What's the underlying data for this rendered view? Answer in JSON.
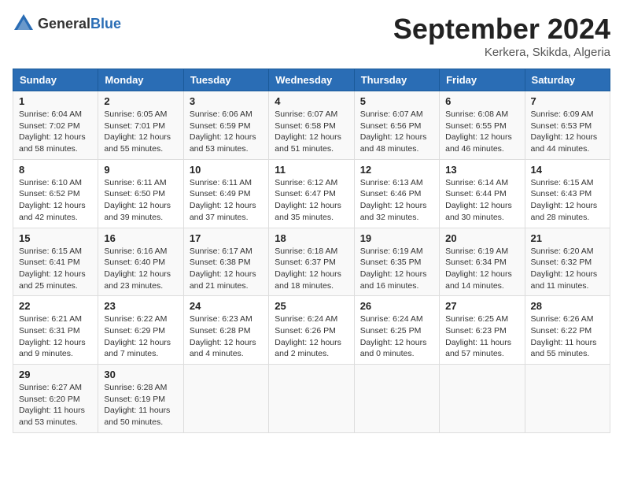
{
  "header": {
    "logo_general": "General",
    "logo_blue": "Blue",
    "title": "September 2024",
    "location": "Kerkera, Skikda, Algeria"
  },
  "columns": [
    "Sunday",
    "Monday",
    "Tuesday",
    "Wednesday",
    "Thursday",
    "Friday",
    "Saturday"
  ],
  "weeks": [
    [
      {
        "day": "1",
        "sunrise": "6:04 AM",
        "sunset": "7:02 PM",
        "daylight": "12 hours and 58 minutes."
      },
      {
        "day": "2",
        "sunrise": "6:05 AM",
        "sunset": "7:01 PM",
        "daylight": "12 hours and 55 minutes."
      },
      {
        "day": "3",
        "sunrise": "6:06 AM",
        "sunset": "6:59 PM",
        "daylight": "12 hours and 53 minutes."
      },
      {
        "day": "4",
        "sunrise": "6:07 AM",
        "sunset": "6:58 PM",
        "daylight": "12 hours and 51 minutes."
      },
      {
        "day": "5",
        "sunrise": "6:07 AM",
        "sunset": "6:56 PM",
        "daylight": "12 hours and 48 minutes."
      },
      {
        "day": "6",
        "sunrise": "6:08 AM",
        "sunset": "6:55 PM",
        "daylight": "12 hours and 46 minutes."
      },
      {
        "day": "7",
        "sunrise": "6:09 AM",
        "sunset": "6:53 PM",
        "daylight": "12 hours and 44 minutes."
      }
    ],
    [
      {
        "day": "8",
        "sunrise": "6:10 AM",
        "sunset": "6:52 PM",
        "daylight": "12 hours and 42 minutes."
      },
      {
        "day": "9",
        "sunrise": "6:11 AM",
        "sunset": "6:50 PM",
        "daylight": "12 hours and 39 minutes."
      },
      {
        "day": "10",
        "sunrise": "6:11 AM",
        "sunset": "6:49 PM",
        "daylight": "12 hours and 37 minutes."
      },
      {
        "day": "11",
        "sunrise": "6:12 AM",
        "sunset": "6:47 PM",
        "daylight": "12 hours and 35 minutes."
      },
      {
        "day": "12",
        "sunrise": "6:13 AM",
        "sunset": "6:46 PM",
        "daylight": "12 hours and 32 minutes."
      },
      {
        "day": "13",
        "sunrise": "6:14 AM",
        "sunset": "6:44 PM",
        "daylight": "12 hours and 30 minutes."
      },
      {
        "day": "14",
        "sunrise": "6:15 AM",
        "sunset": "6:43 PM",
        "daylight": "12 hours and 28 minutes."
      }
    ],
    [
      {
        "day": "15",
        "sunrise": "6:15 AM",
        "sunset": "6:41 PM",
        "daylight": "12 hours and 25 minutes."
      },
      {
        "day": "16",
        "sunrise": "6:16 AM",
        "sunset": "6:40 PM",
        "daylight": "12 hours and 23 minutes."
      },
      {
        "day": "17",
        "sunrise": "6:17 AM",
        "sunset": "6:38 PM",
        "daylight": "12 hours and 21 minutes."
      },
      {
        "day": "18",
        "sunrise": "6:18 AM",
        "sunset": "6:37 PM",
        "daylight": "12 hours and 18 minutes."
      },
      {
        "day": "19",
        "sunrise": "6:19 AM",
        "sunset": "6:35 PM",
        "daylight": "12 hours and 16 minutes."
      },
      {
        "day": "20",
        "sunrise": "6:19 AM",
        "sunset": "6:34 PM",
        "daylight": "12 hours and 14 minutes."
      },
      {
        "day": "21",
        "sunrise": "6:20 AM",
        "sunset": "6:32 PM",
        "daylight": "12 hours and 11 minutes."
      }
    ],
    [
      {
        "day": "22",
        "sunrise": "6:21 AM",
        "sunset": "6:31 PM",
        "daylight": "12 hours and 9 minutes."
      },
      {
        "day": "23",
        "sunrise": "6:22 AM",
        "sunset": "6:29 PM",
        "daylight": "12 hours and 7 minutes."
      },
      {
        "day": "24",
        "sunrise": "6:23 AM",
        "sunset": "6:28 PM",
        "daylight": "12 hours and 4 minutes."
      },
      {
        "day": "25",
        "sunrise": "6:24 AM",
        "sunset": "6:26 PM",
        "daylight": "12 hours and 2 minutes."
      },
      {
        "day": "26",
        "sunrise": "6:24 AM",
        "sunset": "6:25 PM",
        "daylight": "12 hours and 0 minutes."
      },
      {
        "day": "27",
        "sunrise": "6:25 AM",
        "sunset": "6:23 PM",
        "daylight": "11 hours and 57 minutes."
      },
      {
        "day": "28",
        "sunrise": "6:26 AM",
        "sunset": "6:22 PM",
        "daylight": "11 hours and 55 minutes."
      }
    ],
    [
      {
        "day": "29",
        "sunrise": "6:27 AM",
        "sunset": "6:20 PM",
        "daylight": "11 hours and 53 minutes."
      },
      {
        "day": "30",
        "sunrise": "6:28 AM",
        "sunset": "6:19 PM",
        "daylight": "11 hours and 50 minutes."
      },
      null,
      null,
      null,
      null,
      null
    ]
  ]
}
